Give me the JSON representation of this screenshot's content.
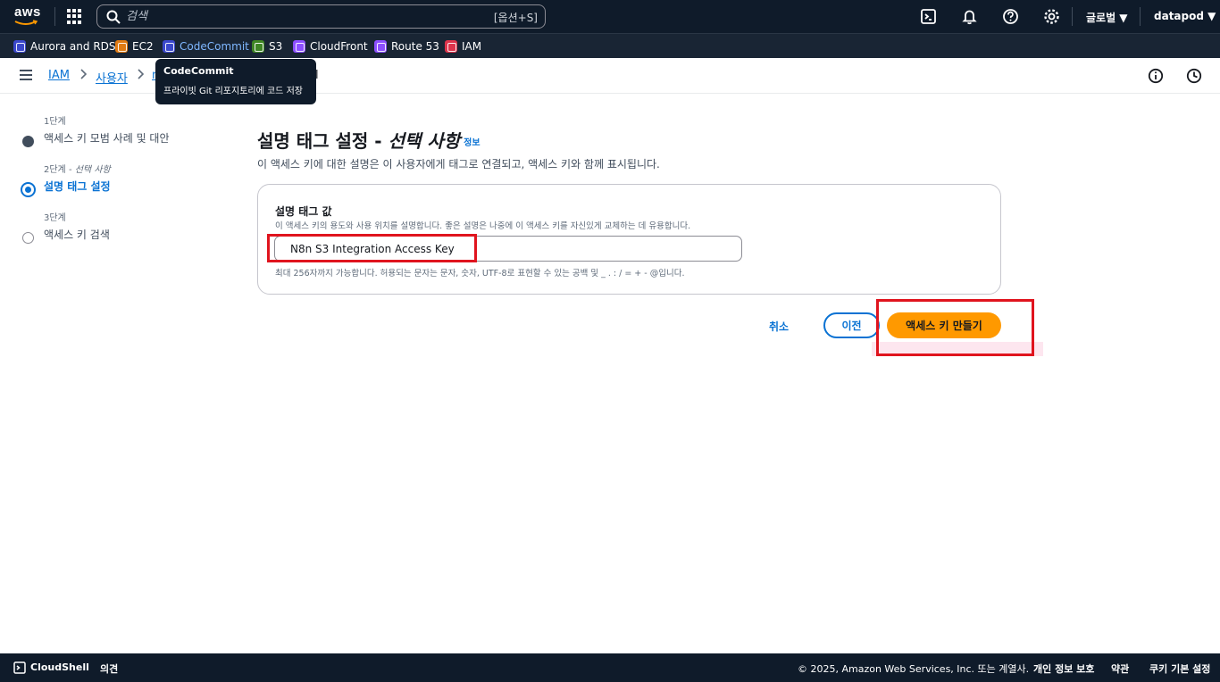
{
  "topnav": {
    "logo_text": "aws",
    "search_placeholder": "검색",
    "search_shortcut": "[옵션+S]",
    "region": "글로벌 ▼",
    "account": "datapod ▼"
  },
  "favorites": [
    {
      "label": "Aurora and RDS",
      "color": "#3b48cc"
    },
    {
      "label": "EC2",
      "color": "#e07b14"
    },
    {
      "label": "CodeCommit",
      "color": "#3b48cc"
    },
    {
      "label": "S3",
      "color": "#3f8624"
    },
    {
      "label": "CloudFront",
      "color": "#8c4fff"
    },
    {
      "label": "Route 53",
      "color": "#8c4fff"
    },
    {
      "label": "IAM",
      "color": "#dd344c"
    }
  ],
  "breadcrumb": {
    "items": [
      "IAM",
      "사용자",
      "n"
    ],
    "tail": "l"
  },
  "tooltip": {
    "title": "CodeCommit",
    "description": "프라이빗 Git 리포지토리에 코드 저장"
  },
  "steps": [
    {
      "number": "1단계",
      "name": "액세스 키 모범 사례 및 대안",
      "state": "done"
    },
    {
      "number": "2단계 - ",
      "number_suffix": "선택 사항",
      "name": "설명 태그 설정",
      "state": "current"
    },
    {
      "number": "3단계",
      "name": "액세스 키 검색",
      "state": "pending"
    }
  ],
  "main": {
    "title": "설명 태그 설정 - ",
    "title_italic": "선택 사항",
    "info_link": "정보",
    "description": "이 액세스 키에 대한 설명은 이 사용자에게 태그로 연결되고, 액세스 키와 함께 표시됩니다.",
    "field": {
      "label": "설명 태그 값",
      "help": "이 액세스 키의 용도와 사용 위치를 설명합니다. 좋은 설명은 나중에 이 액세스 키를 자신있게 교체하는 데 유용합니다.",
      "value": "N8n S3 Integration Access Key",
      "constraint": "최대 256자까지 가능합니다. 허용되는 문자는 문자, 숫자, UTF-8로 표현할 수 있는 공백 및 _ . : / = + - @입니다."
    },
    "buttons": {
      "cancel": "취소",
      "previous": "이전",
      "create": "액세스 키 만들기"
    }
  },
  "footer": {
    "cloudshell": "CloudShell",
    "feedback": "의견",
    "copyright": "© 2025, Amazon Web Services, Inc. 또는 계열사.",
    "privacy": "개인 정보 보호",
    "terms": "약관",
    "cookies": "쿠키 기본 설정"
  },
  "colors": {
    "nav_bg": "#0f1b2a",
    "link": "#0972d3",
    "primary_button": "#ff9900",
    "highlight_box": "#e0141e"
  }
}
